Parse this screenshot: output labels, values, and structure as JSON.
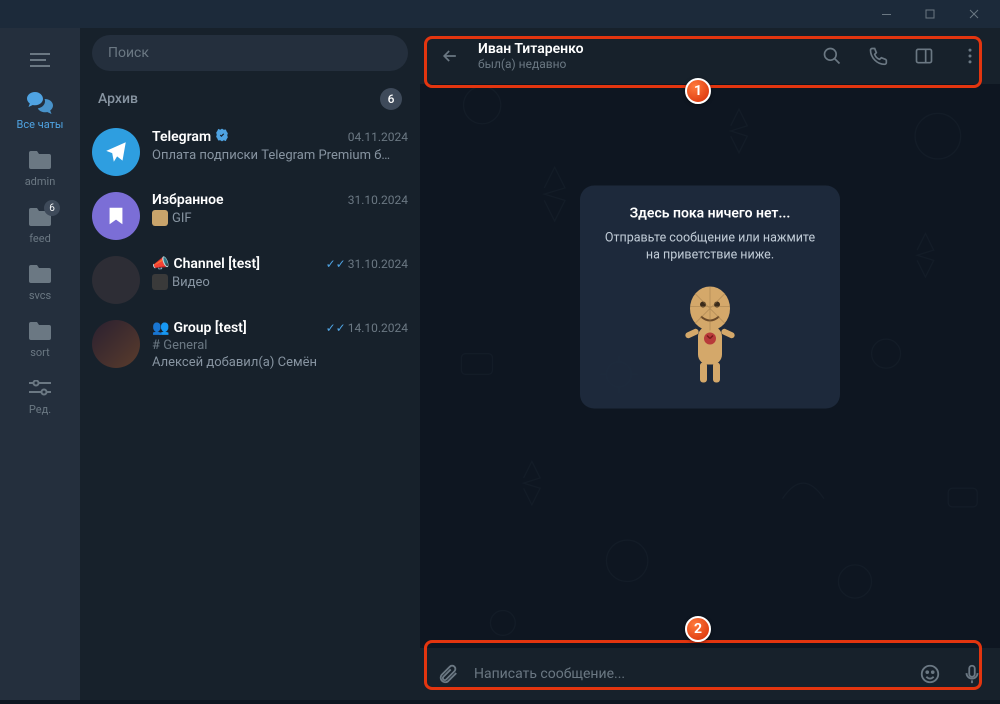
{
  "window": {
    "min": "–",
    "max": "▢",
    "close": "✕"
  },
  "rail": {
    "items": [
      {
        "label": "Все чаты",
        "icon": "chat",
        "active": true
      },
      {
        "label": "admin",
        "icon": "folder"
      },
      {
        "label": "feed",
        "icon": "folder",
        "badge": "6"
      },
      {
        "label": "svcs",
        "icon": "folder"
      },
      {
        "label": "sort",
        "icon": "folder"
      },
      {
        "label": "Ред.",
        "icon": "edit"
      }
    ]
  },
  "search": {
    "placeholder": "Поиск"
  },
  "archive": {
    "label": "Архив",
    "count": "6"
  },
  "chats": [
    {
      "name": "Telegram",
      "verified": true,
      "date": "04.11.2024",
      "preview": "Оплата подписки Telegram Premium б…",
      "avatar": "blue",
      "avicon": "plane"
    },
    {
      "name": "Избранное",
      "date": "31.10.2024",
      "preview": "GIF",
      "thumb": "#c9a46b",
      "avatar": "violet",
      "avicon": "bookmark"
    },
    {
      "name": "Channel [test]",
      "prefix": "megaphone",
      "date": "31.10.2024",
      "ticks": true,
      "preview": "Видео",
      "thumb": "#3a3a3a",
      "avatar": "dark"
    },
    {
      "name": "Group [test]",
      "prefix": "group",
      "date": "14.10.2024",
      "ticks": true,
      "hash": "# General",
      "preview": "Алексей добавил(а) Семён",
      "avatar": "img"
    }
  ],
  "header": {
    "name": "Иван Титаренко",
    "status": "был(а) недавно"
  },
  "emptycard": {
    "title": "Здесь пока ничего нет...",
    "body": "Отправьте сообщение или нажмите на приветствие ниже."
  },
  "composer": {
    "placeholder": "Написать сообщение..."
  },
  "annotations": {
    "n1": "1",
    "n2": "2"
  }
}
